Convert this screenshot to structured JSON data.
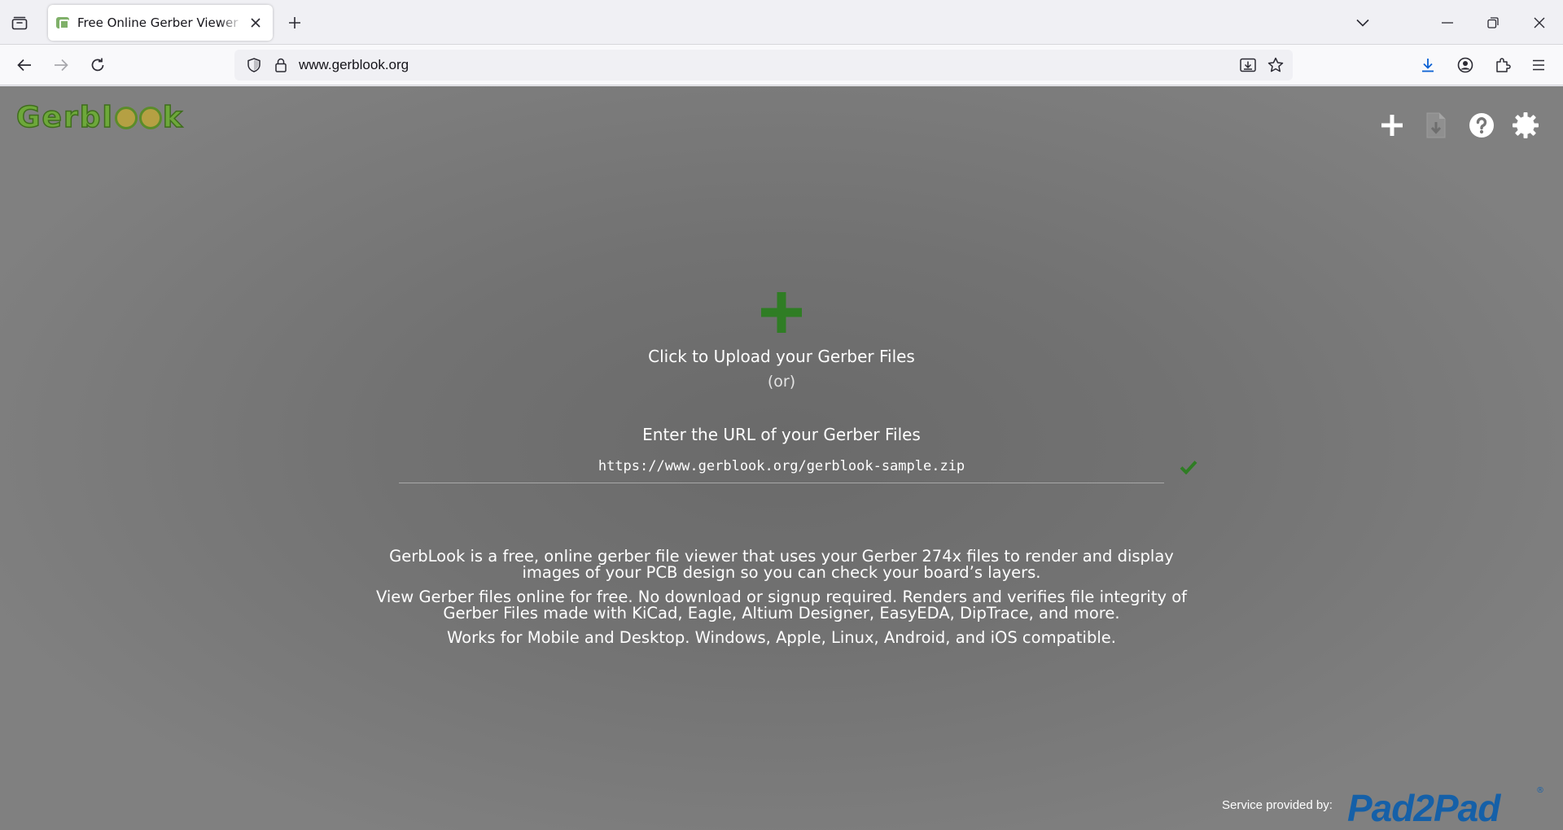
{
  "browser": {
    "tab": {
      "title": "Free Online Gerber Viewer | Circuit Board Viewer | GerbLook"
    },
    "address": "www.gerblook.org"
  },
  "site": {
    "logo_text": "GerbLook",
    "logo_prefix": "Gerbl",
    "logo_suffix": "k",
    "accent_color": "#2f7d24"
  },
  "upload": {
    "prompt": "Click to Upload your Gerber Files",
    "or": "(or)",
    "url_label": "Enter the URL of your Gerber Files",
    "url_value": "https://www.gerblook.org/gerblook-sample.zip"
  },
  "description": [
    "GerbLook is a free, online gerber file viewer that uses your Gerber 274x files to render and display images of your PCB design so you can check your board’s layers.",
    "View Gerber files online for free. No download or signup required. Renders and verifies file integrity of Gerber Files made with KiCad, Eagle, Altium Designer, EasyEDA, DipTrace, and more.",
    "Works for Mobile and Desktop. Windows, Apple, Linux, Android, and iOS compatible."
  ],
  "footer": {
    "service_label": "Service provided by:",
    "provider": "Pad2Pad",
    "provider_mark": "®"
  },
  "icons": {
    "top_right": [
      "plus-icon",
      "download-file-icon",
      "help-icon",
      "settings-gear-icon"
    ]
  }
}
